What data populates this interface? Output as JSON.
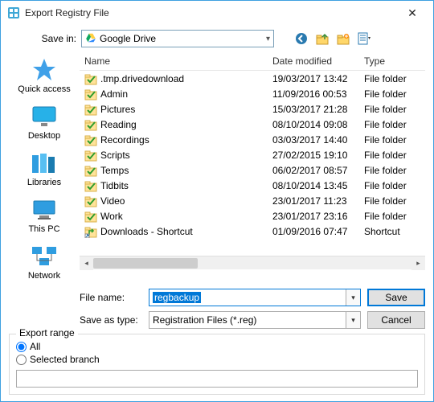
{
  "title": "Export Registry File",
  "savein": {
    "label": "Save in:",
    "value": "Google Drive"
  },
  "columns": {
    "name": "Name",
    "date": "Date modified",
    "type": "Type"
  },
  "places": {
    "quick_access": "Quick access",
    "desktop": "Desktop",
    "libraries": "Libraries",
    "this_pc": "This PC",
    "network": "Network"
  },
  "files": [
    {
      "name": ".tmp.drivedownload",
      "date": "19/03/2017 13:42",
      "type": "File folder",
      "icon": "folder-check"
    },
    {
      "name": "Admin",
      "date": "11/09/2016 00:53",
      "type": "File folder",
      "icon": "folder-check"
    },
    {
      "name": "Pictures",
      "date": "15/03/2017 21:28",
      "type": "File folder",
      "icon": "folder-check"
    },
    {
      "name": "Reading",
      "date": "08/10/2014 09:08",
      "type": "File folder",
      "icon": "folder-check"
    },
    {
      "name": "Recordings",
      "date": "03/03/2017 14:40",
      "type": "File folder",
      "icon": "folder-check"
    },
    {
      "name": "Scripts",
      "date": "27/02/2015 19:10",
      "type": "File folder",
      "icon": "folder-check"
    },
    {
      "name": "Temps",
      "date": "06/02/2017 08:57",
      "type": "File folder",
      "icon": "folder-check"
    },
    {
      "name": "Tidbits",
      "date": "08/10/2014 13:45",
      "type": "File folder",
      "icon": "folder-check"
    },
    {
      "name": "Video",
      "date": "23/01/2017 11:23",
      "type": "File folder",
      "icon": "folder-check"
    },
    {
      "name": "Work",
      "date": "23/01/2017 23:16",
      "type": "File folder",
      "icon": "folder-check"
    },
    {
      "name": "Downloads - Shortcut",
      "date": "01/09/2016 07:47",
      "type": "Shortcut",
      "icon": "shortcut"
    }
  ],
  "form": {
    "file_name_label": "File name:",
    "file_name_value": "regbackup",
    "save_as_type_label": "Save as type:",
    "save_as_type_value": "Registration Files (*.reg)",
    "save": "Save",
    "cancel": "Cancel"
  },
  "export_range": {
    "legend": "Export range",
    "all": "All",
    "selected_branch": "Selected branch",
    "selected": "all",
    "branch_value": ""
  }
}
